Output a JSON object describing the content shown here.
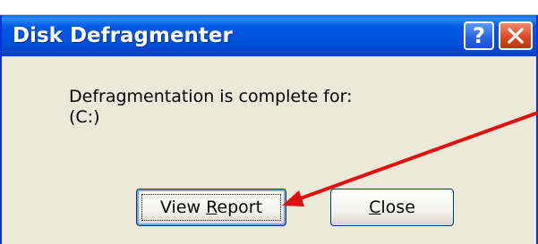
{
  "dialog": {
    "title": "Disk Defragmenter",
    "help_label": "?",
    "message_line1": "Defragmentation is complete for:",
    "message_line2": "(C:)"
  },
  "buttons": {
    "view_report": {
      "before": "View ",
      "mnemonic": "R",
      "after": "eport"
    },
    "close": {
      "mnemonic": "C",
      "after": "lose"
    }
  },
  "colors": {
    "titlebar": "#0058e6",
    "dialog_bg": "#ece9d8",
    "annotation_arrow": "#e01010"
  },
  "icons": {
    "help": "help-icon",
    "close": "close-x-icon"
  }
}
